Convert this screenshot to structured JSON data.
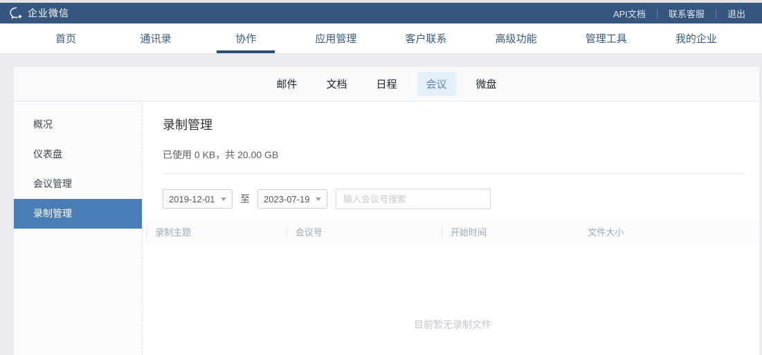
{
  "topbar": {
    "brand": "企业微信",
    "links": [
      {
        "name": "api-docs",
        "label": "API文档"
      },
      {
        "name": "contact-support",
        "label": "联系客服"
      },
      {
        "name": "logout",
        "label": "退出"
      }
    ]
  },
  "nav": {
    "items": [
      {
        "name": "home",
        "label": "首页",
        "active": false
      },
      {
        "name": "contacts",
        "label": "通讯录",
        "active": false
      },
      {
        "name": "collaboration",
        "label": "协作",
        "active": true
      },
      {
        "name": "app-management",
        "label": "应用管理",
        "active": false
      },
      {
        "name": "customer-contact",
        "label": "客户联系",
        "active": false
      },
      {
        "name": "advanced-features",
        "label": "高级功能",
        "active": false
      },
      {
        "name": "admin-tools",
        "label": "管理工具",
        "active": false
      },
      {
        "name": "my-company",
        "label": "我的企业",
        "active": false
      }
    ]
  },
  "subnav": {
    "tabs": [
      {
        "name": "mail",
        "label": "邮件",
        "active": false
      },
      {
        "name": "docs",
        "label": "文档",
        "active": false
      },
      {
        "name": "calendar",
        "label": "日程",
        "active": false
      },
      {
        "name": "meeting",
        "label": "会议",
        "active": true
      },
      {
        "name": "drive",
        "label": "微盘",
        "active": false
      }
    ]
  },
  "sidebar": {
    "items": [
      {
        "name": "overview",
        "label": "概况",
        "active": false
      },
      {
        "name": "dashboard",
        "label": "仪表盘",
        "active": false
      },
      {
        "name": "meeting-management",
        "label": "会议管理",
        "active": false
      },
      {
        "name": "recording-management",
        "label": "录制管理",
        "active": true
      }
    ]
  },
  "main": {
    "title": "录制管理",
    "usage": "已使用 0 KB，共 20.00 GB",
    "filters": {
      "date_from": "2019-12-01",
      "range_separator": "至",
      "date_to": "2023-07-19",
      "search_placeholder": "输入会议号搜索"
    },
    "table": {
      "columns": [
        "录制主题",
        "会议号",
        "开始时间",
        "文件大小"
      ],
      "rows": [],
      "empty_text": "目前暂无录制文件"
    }
  },
  "colors": {
    "topbar_bg": "#35567e",
    "nav_active_underline": "#2e4d75",
    "subnav_active_bg": "#e5effa",
    "subnav_active_text": "#5a82bd",
    "sidebar_active_bg": "#4a7db5",
    "page_bg": "#e9ebee"
  }
}
